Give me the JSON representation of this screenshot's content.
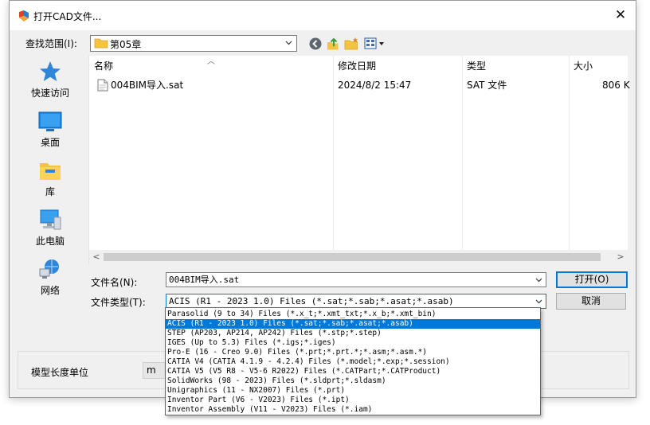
{
  "dialog": {
    "title": "打开CAD文件..."
  },
  "look_in": {
    "label": "查找范围(I):",
    "value": "第05章"
  },
  "places": [
    {
      "label": "快速访问",
      "icon": "star-icon"
    },
    {
      "label": "桌面",
      "icon": "desktop-icon"
    },
    {
      "label": "库",
      "icon": "library-icon"
    },
    {
      "label": "此电脑",
      "icon": "computer-icon"
    },
    {
      "label": "网络",
      "icon": "network-icon"
    }
  ],
  "file_list": {
    "columns": {
      "name": "名称",
      "modified": "修改日期",
      "type": "类型",
      "size": "大小"
    },
    "rows": [
      {
        "name": "004BIM导入.sat",
        "modified": "2024/8/2 15:47",
        "type": "SAT 文件",
        "size": "806 K"
      }
    ]
  },
  "file_name": {
    "label": "文件名(N):",
    "value": "004BIM导入.sat"
  },
  "file_type": {
    "label": "文件类型(T):",
    "value": "ACIS (R1 - 2023 1.0) Files (*.sat;*.sab;*.asat;*.asab)",
    "options": [
      "Parasolid (9 to 34) Files (*.x_t;*.xmt_txt;*.x_b;*.xmt_bin)",
      "ACIS (R1 - 2023 1.0) Files (*.sat;*.sab;*.asat;*.asab)",
      "STEP (AP203, AP214, AP242) Files (*.stp;*.step)",
      "IGES (Up to 5.3) Files (*.igs;*.iges)",
      "Pro-E (16 - Creo 9.0) Files (*.prt;*.prt.*;*.asm;*.asm.*)",
      "CATIA V4 (CATIA 4.1.9 - 4.2.4) Files (*.model;*.exp;*.session)",
      "CATIA V5 (V5 R8 - V5-6 R2022) Files (*.CATPart;*.CATProduct)",
      "SolidWorks (98 - 2023) Files (*.sldprt;*.sldasm)",
      "Unigraphics (11 - NX2007) Files (*.prt)",
      "Inventor Part (V6 - V2023) Files (*.ipt)",
      "Inventor Assembly (V11 - V2023) Files (*.iam)"
    ],
    "selected_index": 1
  },
  "buttons": {
    "open": "打开(O)",
    "cancel": "取消"
  },
  "units": {
    "label": "模型长度单位",
    "value": "m"
  },
  "colors": {
    "accent": "#0078d7",
    "folder": "#f5c342",
    "dialog_bg": "#f0f0f0"
  }
}
